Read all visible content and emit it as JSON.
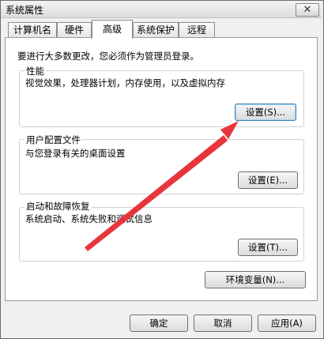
{
  "window": {
    "title": "系统属性",
    "close_glyph": "✕"
  },
  "tabs": [
    {
      "label": "计算机名"
    },
    {
      "label": "硬件"
    },
    {
      "label": "高级",
      "active": true
    },
    {
      "label": "系统保护"
    },
    {
      "label": "远程"
    }
  ],
  "admin_note": "要进行大多数更改，您必须作为管理员登录。",
  "sections": {
    "performance": {
      "title": "性能",
      "description": "视觉效果，处理器计划，内存使用，以及虚拟内存",
      "button": "设置(S)..."
    },
    "user_profiles": {
      "title": "用户配置文件",
      "description": "与您登录有关的桌面设置",
      "button": "设置(E)..."
    },
    "startup_recovery": {
      "title": "启动和故障恢复",
      "description": "系统启动、系统失败和调试信息",
      "button": "设置(T)..."
    }
  },
  "env_button": "环境变量(N)...",
  "footer": {
    "ok": "确定",
    "cancel": "取消",
    "apply": "应用(A)"
  },
  "annotation": {
    "color": "#e8353c",
    "points_to": "performance-settings-button"
  }
}
